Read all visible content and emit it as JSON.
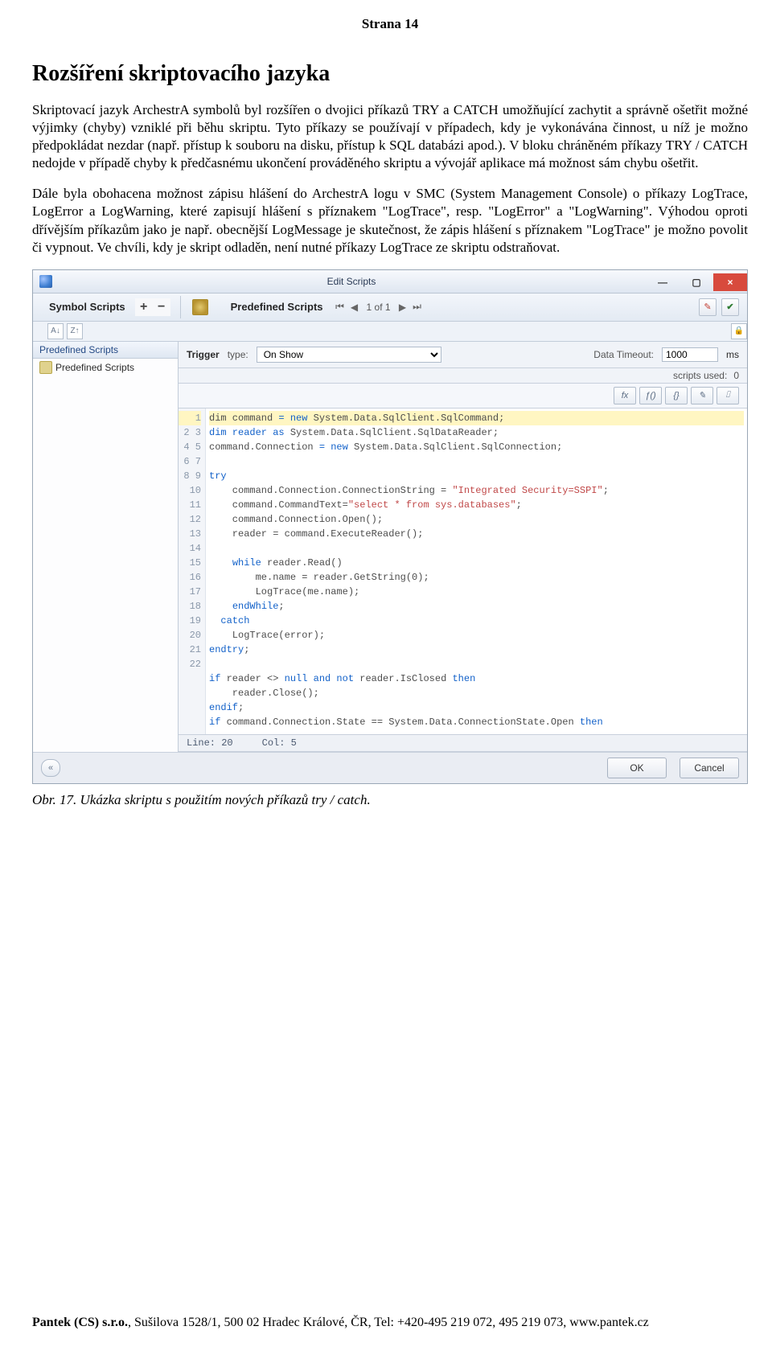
{
  "page": {
    "top": "Strana 14",
    "heading": "Rozšíření skriptovacího jazyka",
    "para1": "Skriptovací jazyk ArchestrA symbolů byl rozšířen o dvojici příkazů TRY a CATCH umožňující zachytit a správně ošetřit možné výjimky (chyby) vzniklé při běhu skriptu. Tyto příkazy se používají v případech, kdy je vykonávána činnost, u níž je možno předpokládat nezdar (např. přístup k souboru na disku, přístup k SQL databázi apod.). V bloku chráněném příkazy TRY / CATCH nedojde v případě chyby k předčasnému ukončení prováděného skriptu a vývojář aplikace má možnost sám chybu ošetřit.",
    "para2": "Dále byla obohacena možnost zápisu hlášení do ArchestrA logu v SMC (System Management Console) o příkazy LogTrace, LogError a LogWarning, které zapisují hlášení s příznakem \"LogTrace\", resp. \"LogError\" a \"LogWarning\". Výhodou oproti dřívějším příkazům jako je např. obecnější LogMessage je skutečnost, že zápis hlášení s příznakem \"LogTrace\" je možno povolit či vypnout. Ve chvíli, kdy je skript odladěn, není nutné příkazy LogTrace ze skriptu odstraňovat.",
    "caption": "Obr. 17. Ukázka skriptu s použitím nových příkazů try / catch.",
    "footer": "Pantek (CS) s.r.o., Sušilova 1528/1, 500 02 Hradec Králové, ČR, Tel: +420-495 219 072, 495 219 073, www.pantek.cz"
  },
  "shot": {
    "title": "Edit Scripts",
    "win_min": "—",
    "win_max": "▢",
    "win_close": "×",
    "toolbar": {
      "symbol_scripts": "Symbol Scripts",
      "plus": "+",
      "minus": "−",
      "predef": "Predefined Scripts",
      "nav_prev2": "⏮",
      "nav_prev": "◀",
      "nav_text": "1 of 1",
      "nav_next": "▶",
      "nav_next2": "⏭"
    },
    "tree": {
      "header": "Predefined Scripts",
      "item1": "Predefined Scripts"
    },
    "trigger": {
      "label": "Trigger",
      "type_lbl": "type:",
      "type_val": "On Show",
      "dt_label": "Data Timeout:",
      "dt_val": "1000",
      "ms": "ms",
      "scripts_used_lbl": "scripts used:",
      "scripts_used_val": "0"
    },
    "fx": {
      "a": "fx",
      "b": "ƒ()",
      "c": "{}",
      "d": "✎",
      "e": "⌷"
    },
    "code_lines": [
      {
        "n": 1,
        "hl": true,
        "segs": [
          [
            "",
            "dim command "
          ],
          [
            "kw",
            "= new"
          ],
          [
            "",
            " System.Data.SqlClient.SqlCommand;"
          ]
        ]
      },
      {
        "n": 2,
        "segs": [
          [
            "kw",
            "dim reader as"
          ],
          [
            "",
            " System.Data.SqlClient.SqlDataReader;"
          ]
        ]
      },
      {
        "n": 3,
        "segs": [
          [
            "",
            "command.Connection "
          ],
          [
            "kw",
            "= new"
          ],
          [
            "",
            " System.Data.SqlClient.SqlConnection;"
          ]
        ]
      },
      {
        "n": 4,
        "segs": [
          [
            "",
            ""
          ]
        ]
      },
      {
        "n": 5,
        "segs": [
          [
            "kw",
            "try"
          ]
        ]
      },
      {
        "n": 6,
        "segs": [
          [
            "",
            "    command.Connection.ConnectionString = "
          ],
          [
            "str",
            "\"Integrated Security=SSPI\""
          ],
          [
            "",
            ";"
          ]
        ]
      },
      {
        "n": 7,
        "segs": [
          [
            "",
            "    command.CommandText="
          ],
          [
            "str",
            "\"select * from sys.databases\""
          ],
          [
            "",
            ";"
          ]
        ]
      },
      {
        "n": 8,
        "segs": [
          [
            "",
            "    command.Connection.Open();"
          ]
        ]
      },
      {
        "n": 9,
        "segs": [
          [
            "",
            "    reader = command.ExecuteReader();"
          ]
        ]
      },
      {
        "n": 10,
        "segs": [
          [
            "",
            ""
          ]
        ]
      },
      {
        "n": 11,
        "segs": [
          [
            "",
            "    "
          ],
          [
            "kw",
            "while"
          ],
          [
            "",
            " reader.Read()"
          ]
        ]
      },
      {
        "n": 12,
        "segs": [
          [
            "",
            "        me.name = reader.GetString(0);"
          ]
        ]
      },
      {
        "n": 13,
        "segs": [
          [
            "",
            "        LogTrace(me.name);"
          ]
        ]
      },
      {
        "n": 14,
        "segs": [
          [
            "",
            "    "
          ],
          [
            "kw",
            "endWhile"
          ],
          [
            "",
            ";"
          ]
        ]
      },
      {
        "n": 15,
        "segs": [
          [
            "",
            "  "
          ],
          [
            "kw",
            "catch"
          ]
        ]
      },
      {
        "n": 16,
        "segs": [
          [
            "",
            "    LogTrace(error);"
          ]
        ]
      },
      {
        "n": 17,
        "segs": [
          [
            "kw",
            "endtry"
          ],
          [
            "",
            ";"
          ]
        ]
      },
      {
        "n": 18,
        "segs": [
          [
            "",
            ""
          ]
        ]
      },
      {
        "n": 19,
        "segs": [
          [
            "kw",
            "if"
          ],
          [
            "",
            " reader <> "
          ],
          [
            "kw",
            "null and not"
          ],
          [
            "",
            " reader.IsClosed "
          ],
          [
            "kw",
            "then"
          ]
        ]
      },
      {
        "n": 20,
        "segs": [
          [
            "",
            "    reader.Close();"
          ]
        ]
      },
      {
        "n": 21,
        "segs": [
          [
            "kw",
            "endif"
          ],
          [
            "",
            ";"
          ]
        ]
      },
      {
        "n": 22,
        "segs": [
          [
            "kw",
            "if"
          ],
          [
            "",
            " command.Connection.State == System.Data.ConnectionState.Open "
          ],
          [
            "kw",
            "then"
          ]
        ]
      }
    ],
    "status": {
      "line_lbl": "Line:",
      "line": "20",
      "col_lbl": "Col:",
      "col": "5"
    },
    "foot": {
      "left": "«",
      "ok": "OK",
      "cancel": "Cancel"
    }
  }
}
